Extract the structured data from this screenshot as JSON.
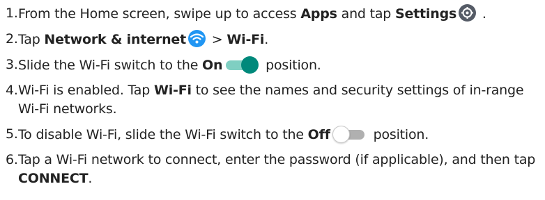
{
  "steps": [
    {
      "num": "1.",
      "t1": "From the Home screen, swipe up to access ",
      "b1": "Apps",
      "t2": " and tap ",
      "b2": "Settings",
      "t3": " ."
    },
    {
      "num": "2.",
      "t1": "Tap ",
      "b1": "Network & internet",
      "t2": " > ",
      "b2": "Wi-Fi",
      "t3": "."
    },
    {
      "num": "3.",
      "t1": "Slide the Wi-Fi switch to the ",
      "b1": "On",
      "t2": " position."
    },
    {
      "num": "4.",
      "t1": "Wi-Fi is enabled. Tap ",
      "b1": "Wi-Fi",
      "t2": " to see the names and security settings of in-range Wi-Fi networks."
    },
    {
      "num": "5.",
      "t1": "To disable Wi-Fi, slide the Wi-Fi switch to the ",
      "b1": "Off",
      "t2": " position."
    },
    {
      "num": "6.",
      "t1": "Tap a Wi-Fi network to connect, enter the password (if applicable), and then tap ",
      "b1": "CONNECT",
      "t2": "."
    }
  ],
  "icons": {
    "settings": "settings-gear-icon",
    "wifi": "wifi-icon",
    "toggle_on": "toggle-on-icon",
    "toggle_off": "toggle-off-icon"
  },
  "colors": {
    "text": "#222222",
    "settings_icon": "#555b66",
    "wifi_icon": "#2196f3",
    "toggle_on_knob": "#00897b",
    "toggle_on_track": "#7fcfc2",
    "toggle_off_track": "#b0b0b0"
  }
}
